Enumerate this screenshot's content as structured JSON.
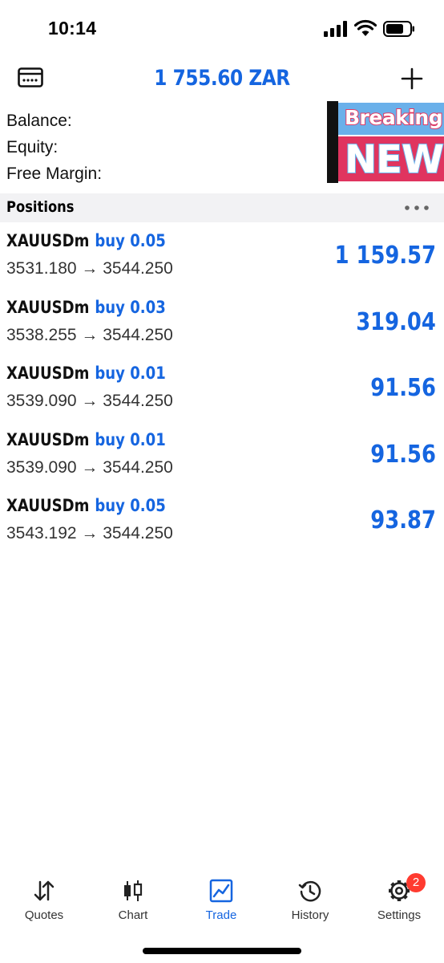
{
  "status_bar": {
    "time": "10:14"
  },
  "header": {
    "title": "1 755.60 ZAR"
  },
  "summary": {
    "balance_label": "Balance:",
    "equity_label": "Equity:",
    "free_margin_label": "Free Margin:"
  },
  "overlay": {
    "line1": "Breaking",
    "line2": "NEWS"
  },
  "positions_header": {
    "title": "Positions"
  },
  "positions": [
    {
      "symbol": "XAUUSDm",
      "side": "buy 0.05",
      "prices": "3531.180 → 3544.250",
      "profit": "1 159.57"
    },
    {
      "symbol": "XAUUSDm",
      "side": "buy 0.03",
      "prices": "3538.255 → 3544.250",
      "profit": "319.04"
    },
    {
      "symbol": "XAUUSDm",
      "side": "buy 0.01",
      "prices": "3539.090 → 3544.250",
      "profit": "91.56"
    },
    {
      "symbol": "XAUUSDm",
      "side": "buy 0.01",
      "prices": "3539.090 → 3544.250",
      "profit": "91.56"
    },
    {
      "symbol": "XAUUSDm",
      "side": "buy 0.05",
      "prices": "3543.192 → 3544.250",
      "profit": "93.87"
    }
  ],
  "tabs": [
    {
      "label": "Quotes",
      "icon": "quotes-arrows-icon"
    },
    {
      "label": "Chart",
      "icon": "candlestick-icon"
    },
    {
      "label": "Trade",
      "icon": "trade-chart-icon",
      "active": true
    },
    {
      "label": "History",
      "icon": "history-clock-icon"
    },
    {
      "label": "Settings",
      "icon": "gear-icon",
      "badge": "2"
    }
  ],
  "colors": {
    "accent": "#1565e0",
    "badge": "#ff3b30",
    "section_bg": "#f2f2f4"
  }
}
